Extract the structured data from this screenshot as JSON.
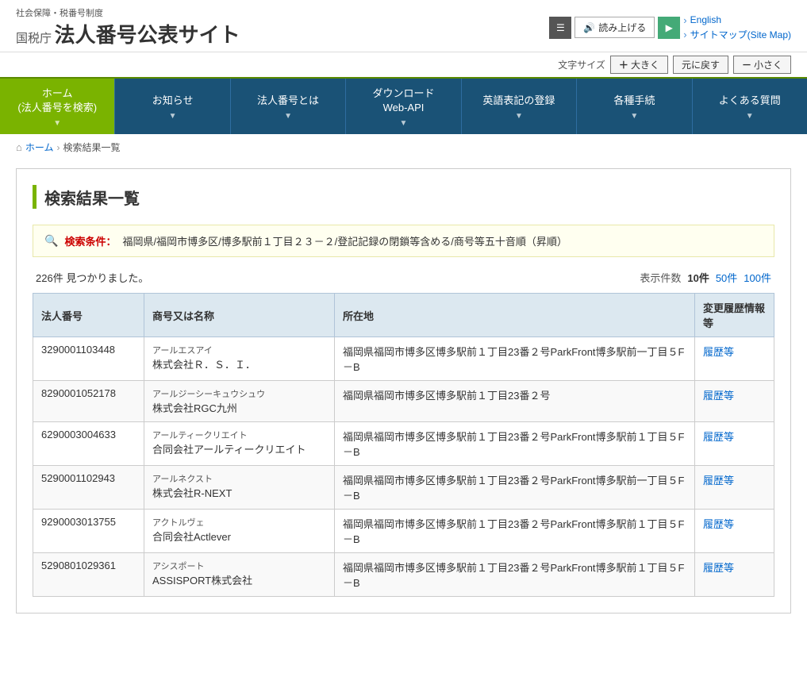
{
  "header": {
    "subtitle": "社会保障・税番号制度",
    "org": "国税庁",
    "title": "法人番号公表サイト",
    "read_aloud_label": "読み上げる",
    "menu_icon": "☰",
    "play_icon": "▶",
    "english_link": "English",
    "sitemap_link": "サイトマップ(Site Map)",
    "font_size_label": "文字サイズ",
    "font_large_label": "大きく",
    "font_reset_label": "元に戻す",
    "font_small_label": "小さく"
  },
  "nav": {
    "items": [
      {
        "label": "ホーム\n(法人番号を検索)",
        "id": "home"
      },
      {
        "label": "お知らせ",
        "id": "news"
      },
      {
        "label": "法人番号とは",
        "id": "about"
      },
      {
        "label": "ダウンロード\nWeb-API",
        "id": "download"
      },
      {
        "label": "英語表記の登録",
        "id": "english-reg"
      },
      {
        "label": "各種手続",
        "id": "procedures"
      },
      {
        "label": "よくある質問",
        "id": "faq"
      }
    ]
  },
  "breadcrumb": {
    "home_label": "ホーム",
    "current": "検索結果一覧"
  },
  "page": {
    "title": "検索結果一覧",
    "search_label": "検索条件：",
    "search_condition": "福岡県/福岡市博多区/博多駅前１丁目２３－２/登記記録の閉鎖等含める/商号等五十音順（昇順）",
    "results_count_num": "226件",
    "results_count_suffix": "見つかりました。",
    "display_count_label": "表示件数",
    "display_count_current": "10件",
    "display_50": "50件",
    "display_100": "100件"
  },
  "table": {
    "headers": [
      "法人番号",
      "商号又は名称",
      "所在地",
      "変更履歴情報等"
    ],
    "rows": [
      {
        "corporate_num": "3290001103448",
        "ruby": "アールエスアイ",
        "name": "株式会社Ｒ．Ｓ．Ｉ．",
        "address": "福岡県福岡市博多区博多駅前１丁目23番２号ParkFront博多駅前一丁目５F－B",
        "history_link": "履歴等"
      },
      {
        "corporate_num": "8290001052178",
        "ruby": "アールジーシーキュウシュウ",
        "name": "株式会社RGC九州",
        "address": "福岡県福岡市博多区博多駅前１丁目23番２号",
        "history_link": "履歴等"
      },
      {
        "corporate_num": "6290003004633",
        "ruby": "アールティークリエイト",
        "name": "合同会社アールティークリエイト",
        "address": "福岡県福岡市博多区博多駅前１丁目23番２号ParkFront博多駅前１丁目５F－B",
        "history_link": "履歴等"
      },
      {
        "corporate_num": "5290001102943",
        "ruby": "アールネクスト",
        "name": "株式会社R-NEXT",
        "address": "福岡県福岡市博多区博多駅前１丁目23番２号ParkFront博多駅前一丁目５F－B",
        "history_link": "履歴等"
      },
      {
        "corporate_num": "9290003013755",
        "ruby": "アクトルヴェ",
        "name": "合同会社Actlever",
        "address": "福岡県福岡市博多区博多駅前１丁目23番２号ParkFront博多駅前１丁目５F－B",
        "history_link": "履歴等"
      },
      {
        "corporate_num": "5290801029361",
        "ruby": "アシスポート",
        "name": "ASSISPORT株式会社",
        "address": "福岡県福岡市博多区博多駅前１丁目23番２号ParkFront博多駅前１丁目５F－B",
        "history_link": "履歴等"
      }
    ]
  }
}
